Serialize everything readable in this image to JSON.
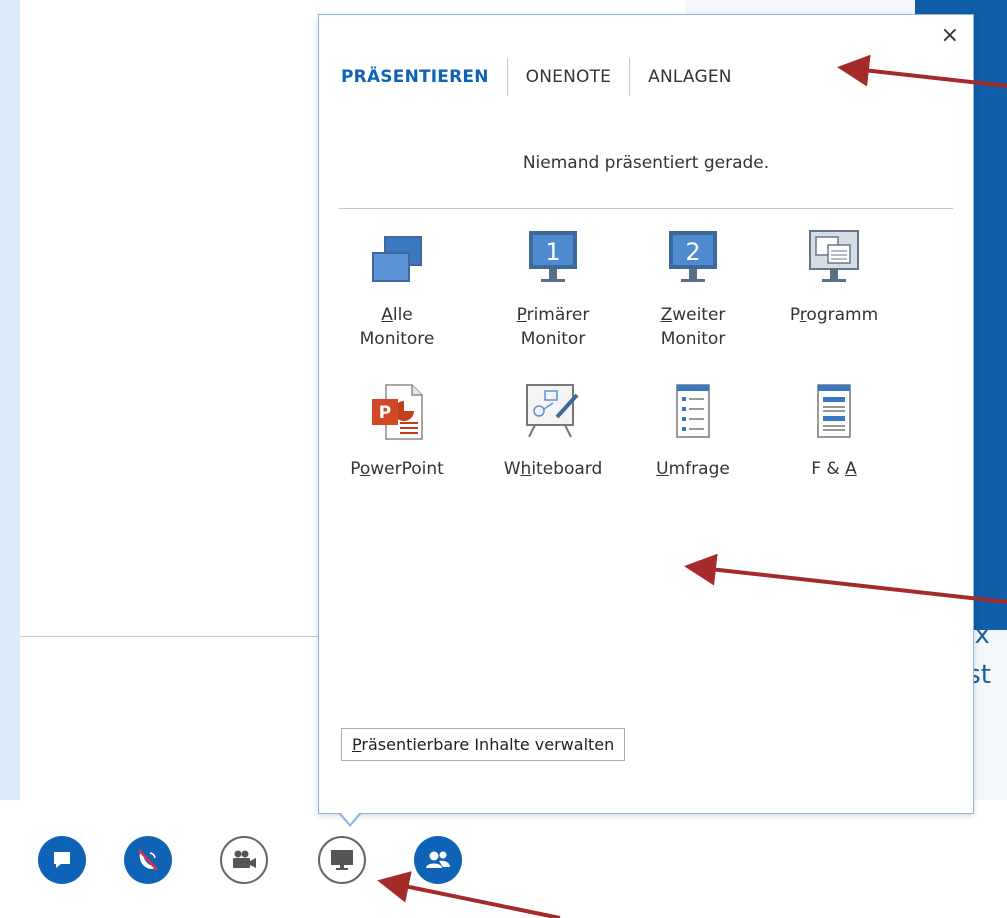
{
  "popup": {
    "close_glyph": "×",
    "tabs": [
      {
        "label": "PRÄSENTIEREN",
        "active": true
      },
      {
        "label": "ONENOTE",
        "active": false
      },
      {
        "label": "ANLAGEN",
        "active": false
      }
    ],
    "status": "Niemand präsentiert gerade.",
    "tiles": [
      {
        "pre": "",
        "key": "A",
        "post": "lle",
        "line2": "Monitore",
        "icon": "all-monitors-icon"
      },
      {
        "pre": "",
        "key": "P",
        "post": "rimärer",
        "line2": "Monitor",
        "icon": "primary-monitor-icon"
      },
      {
        "pre": "",
        "key": "Z",
        "post": "weiter",
        "line2": "Monitor",
        "icon": "second-monitor-icon"
      },
      {
        "pre": "P",
        "key": "r",
        "post": "ogramm",
        "line2": "",
        "icon": "program-icon"
      },
      {
        "pre": "P",
        "key": "o",
        "post": "werPoint",
        "line2": "",
        "icon": "powerpoint-icon"
      },
      {
        "pre": "W",
        "key": "h",
        "post": "iteboard",
        "line2": "",
        "icon": "whiteboard-icon"
      },
      {
        "pre": "",
        "key": "U",
        "post": "mfrage",
        "line2": "",
        "icon": "poll-icon"
      },
      {
        "pre": "F & ",
        "key": "A",
        "post": "",
        "line2": "",
        "icon": "qa-icon"
      }
    ],
    "manage": {
      "key": "P",
      "rest": "räsentierbare Inhalte verwalten"
    }
  },
  "background": {
    "partial_text_1": "lix",
    "partial_text_2": "ıst"
  },
  "toolbar": [
    {
      "name": "chat-button",
      "icon": "chat-icon"
    },
    {
      "name": "audio-button",
      "icon": "muted-phone-icon"
    },
    {
      "name": "video-button",
      "icon": "video-camera-icon"
    },
    {
      "name": "present-button",
      "icon": "monitor-icon"
    },
    {
      "name": "participants-button",
      "icon": "people-icon"
    }
  ],
  "colors": {
    "accent": "#0f63b7",
    "annotation_arrow": "#a52a2a",
    "side_panel": "#0e5ea8"
  }
}
